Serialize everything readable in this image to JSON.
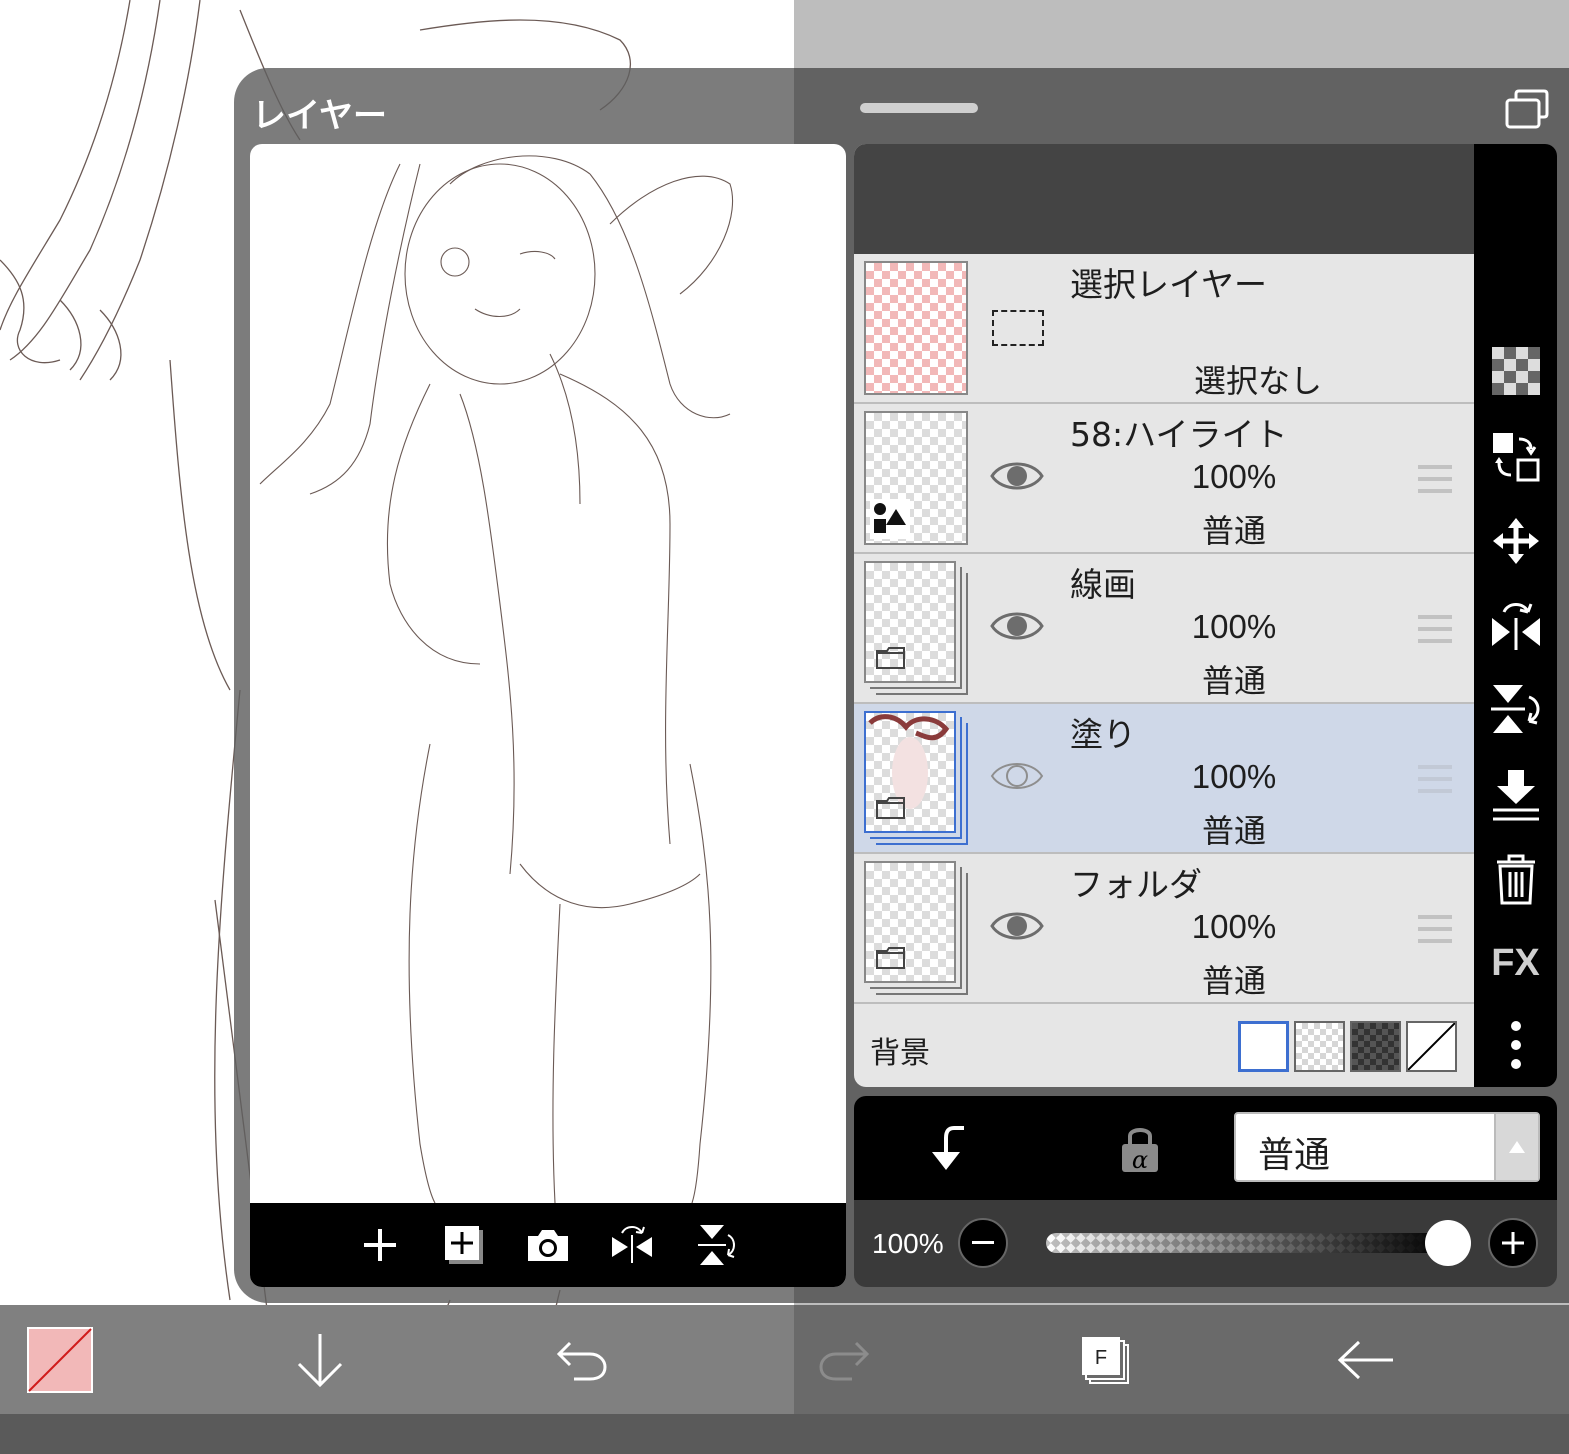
{
  "panel": {
    "title": "レイヤー"
  },
  "layers": [
    {
      "name": "選択レイヤー",
      "status": "選択なし",
      "type": "selection"
    },
    {
      "name": "58:ハイライト",
      "opacity": "100%",
      "mode": "普通",
      "type": "shape",
      "visible": true,
      "selected": false
    },
    {
      "name": "線画",
      "opacity": "100%",
      "mode": "普通",
      "type": "folder",
      "visible": true,
      "selected": false
    },
    {
      "name": "塗り",
      "opacity": "100%",
      "mode": "普通",
      "type": "folder",
      "visible": true,
      "selected": true
    },
    {
      "name": "フォルダ",
      "opacity": "100%",
      "mode": "普通",
      "type": "folder",
      "visible": true,
      "selected": false
    }
  ],
  "background": {
    "label": "背景",
    "options": [
      "white",
      "checker-light",
      "checker-dark",
      "none"
    ],
    "selected": "white"
  },
  "tools": [
    "transparency-icon",
    "swap-icon",
    "move-icon",
    "flip-horizontal-icon",
    "flip-vertical-icon",
    "merge-down-icon",
    "trash-icon",
    "fx",
    "more-icon"
  ],
  "tools_fx_label": "FX",
  "blend": {
    "mode": "普通"
  },
  "opacity": {
    "label": "100%",
    "value": 1.0
  },
  "preview_toolbar": [
    "add-layer-icon",
    "add-layer-copy-icon",
    "camera-icon",
    "flip-horizontal-icon",
    "flip-vertical-icon"
  ],
  "bottom_toolbar": [
    "color-swatch",
    "arrow-down-icon",
    "undo-icon",
    "redo-icon",
    "layers-icon",
    "back-icon"
  ],
  "bottom_layers_badge": "F",
  "colors": {
    "accent_blue": "#3d6fd0",
    "selected_row": "#cfd8e8",
    "swatch_pink": "#f2b8b8"
  }
}
